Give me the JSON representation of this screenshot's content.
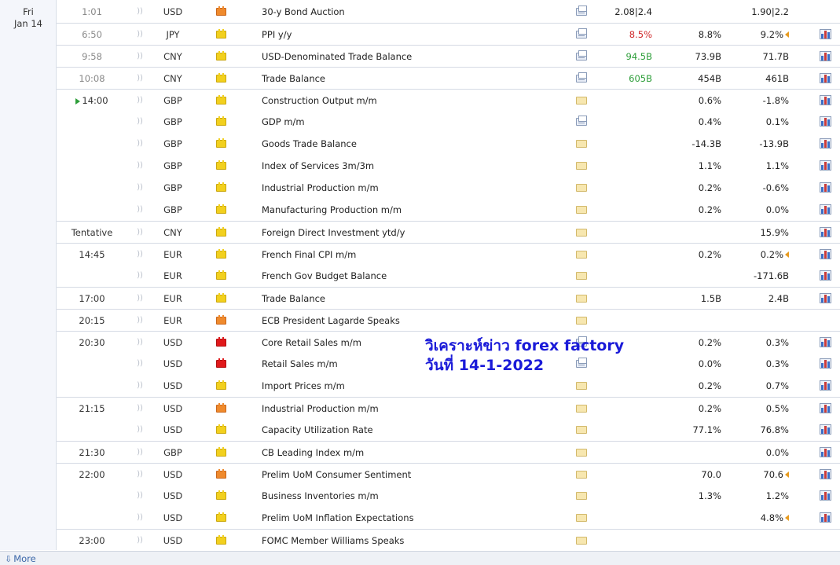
{
  "date": {
    "day": "Fri",
    "month_day": "Jan 14"
  },
  "rows": [
    {
      "time": "1:01",
      "time_state": "past",
      "currency": "USD",
      "impact": "med",
      "event": "30-y Bond Auction",
      "detail": "doc",
      "actual": "2.08|2.4",
      "actual_state": "neutral",
      "forecast": "",
      "previous": "1.90|2.2",
      "prev_rev": false,
      "graph": false,
      "sep": false
    },
    {
      "time": "6:50",
      "time_state": "past",
      "currency": "JPY",
      "impact": "low",
      "event": "PPI y/y",
      "detail": "doc",
      "actual": "8.5%",
      "actual_state": "bad",
      "forecast": "8.8%",
      "previous": "9.2%",
      "prev_rev": true,
      "graph": true,
      "sep": true
    },
    {
      "time": "9:58",
      "time_state": "past",
      "currency": "CNY",
      "impact": "low",
      "event": "USD-Denominated Trade Balance",
      "detail": "doc",
      "actual": "94.5B",
      "actual_state": "good",
      "forecast": "73.9B",
      "previous": "71.7B",
      "prev_rev": false,
      "graph": true,
      "sep": true
    },
    {
      "time": "10:08",
      "time_state": "past",
      "currency": "CNY",
      "impact": "low",
      "event": "Trade Balance",
      "detail": "doc",
      "actual": "605B",
      "actual_state": "good",
      "forecast": "454B",
      "previous": "461B",
      "prev_rev": false,
      "graph": true,
      "sep": true
    },
    {
      "time": "14:00",
      "time_state": "now",
      "currency": "GBP",
      "impact": "low",
      "event": "Construction Output m/m",
      "detail": "folder",
      "actual": "",
      "actual_state": "neutral",
      "forecast": "0.6%",
      "previous": "-1.8%",
      "prev_rev": false,
      "graph": true,
      "sep": true
    },
    {
      "time": "",
      "time_state": "",
      "currency": "GBP",
      "impact": "low",
      "event": "GDP m/m",
      "detail": "doc",
      "actual": "",
      "actual_state": "neutral",
      "forecast": "0.4%",
      "previous": "0.1%",
      "prev_rev": false,
      "graph": true,
      "sep": false
    },
    {
      "time": "",
      "time_state": "",
      "currency": "GBP",
      "impact": "low",
      "event": "Goods Trade Balance",
      "detail": "folder",
      "actual": "",
      "actual_state": "neutral",
      "forecast": "-14.3B",
      "previous": "-13.9B",
      "prev_rev": false,
      "graph": true,
      "sep": false
    },
    {
      "time": "",
      "time_state": "",
      "currency": "GBP",
      "impact": "low",
      "event": "Index of Services 3m/3m",
      "detail": "folder",
      "actual": "",
      "actual_state": "neutral",
      "forecast": "1.1%",
      "previous": "1.1%",
      "prev_rev": false,
      "graph": true,
      "sep": false
    },
    {
      "time": "",
      "time_state": "",
      "currency": "GBP",
      "impact": "low",
      "event": "Industrial Production m/m",
      "detail": "folder",
      "actual": "",
      "actual_state": "neutral",
      "forecast": "0.2%",
      "previous": "-0.6%",
      "prev_rev": false,
      "graph": true,
      "sep": false
    },
    {
      "time": "",
      "time_state": "",
      "currency": "GBP",
      "impact": "low",
      "event": "Manufacturing Production m/m",
      "detail": "folder",
      "actual": "",
      "actual_state": "neutral",
      "forecast": "0.2%",
      "previous": "0.0%",
      "prev_rev": false,
      "graph": true,
      "sep": false
    },
    {
      "time": "Tentative",
      "time_state": "",
      "currency": "CNY",
      "impact": "low",
      "event": "Foreign Direct Investment ytd/y",
      "detail": "folder",
      "actual": "",
      "actual_state": "neutral",
      "forecast": "",
      "previous": "15.9%",
      "prev_rev": false,
      "graph": true,
      "sep": true
    },
    {
      "time": "14:45",
      "time_state": "",
      "currency": "EUR",
      "impact": "low",
      "event": "French Final CPI m/m",
      "detail": "folder",
      "actual": "",
      "actual_state": "neutral",
      "forecast": "0.2%",
      "previous": "0.2%",
      "prev_rev": true,
      "graph": true,
      "sep": true
    },
    {
      "time": "",
      "time_state": "",
      "currency": "EUR",
      "impact": "low",
      "event": "French Gov Budget Balance",
      "detail": "folder",
      "actual": "",
      "actual_state": "neutral",
      "forecast": "",
      "previous": "-171.6B",
      "prev_rev": false,
      "graph": true,
      "sep": false
    },
    {
      "time": "17:00",
      "time_state": "",
      "currency": "EUR",
      "impact": "low",
      "event": "Trade Balance",
      "detail": "folder",
      "actual": "",
      "actual_state": "neutral",
      "forecast": "1.5B",
      "previous": "2.4B",
      "prev_rev": false,
      "graph": true,
      "sep": true
    },
    {
      "time": "20:15",
      "time_state": "",
      "currency": "EUR",
      "impact": "med",
      "event": "ECB President Lagarde Speaks",
      "detail": "folder",
      "actual": "",
      "actual_state": "neutral",
      "forecast": "",
      "previous": "",
      "prev_rev": false,
      "graph": false,
      "sep": true
    },
    {
      "time": "20:30",
      "time_state": "",
      "currency": "USD",
      "impact": "high",
      "event": "Core Retail Sales m/m",
      "detail": "doc",
      "actual": "",
      "actual_state": "neutral",
      "forecast": "0.2%",
      "previous": "0.3%",
      "prev_rev": false,
      "graph": true,
      "sep": true
    },
    {
      "time": "",
      "time_state": "",
      "currency": "USD",
      "impact": "high",
      "event": "Retail Sales m/m",
      "detail": "doc",
      "actual": "",
      "actual_state": "neutral",
      "forecast": "0.0%",
      "previous": "0.3%",
      "prev_rev": false,
      "graph": true,
      "sep": false
    },
    {
      "time": "",
      "time_state": "",
      "currency": "USD",
      "impact": "low",
      "event": "Import Prices m/m",
      "detail": "folder",
      "actual": "",
      "actual_state": "neutral",
      "forecast": "0.2%",
      "previous": "0.7%",
      "prev_rev": false,
      "graph": true,
      "sep": false
    },
    {
      "time": "21:15",
      "time_state": "",
      "currency": "USD",
      "impact": "med",
      "event": "Industrial Production m/m",
      "detail": "folder",
      "actual": "",
      "actual_state": "neutral",
      "forecast": "0.2%",
      "previous": "0.5%",
      "prev_rev": false,
      "graph": true,
      "sep": true
    },
    {
      "time": "",
      "time_state": "",
      "currency": "USD",
      "impact": "low",
      "event": "Capacity Utilization Rate",
      "detail": "folder",
      "actual": "",
      "actual_state": "neutral",
      "forecast": "77.1%",
      "previous": "76.8%",
      "prev_rev": false,
      "graph": true,
      "sep": false
    },
    {
      "time": "21:30",
      "time_state": "",
      "currency": "GBP",
      "impact": "low",
      "event": "CB Leading Index m/m",
      "detail": "folder",
      "actual": "",
      "actual_state": "neutral",
      "forecast": "",
      "previous": "0.0%",
      "prev_rev": false,
      "graph": true,
      "sep": true
    },
    {
      "time": "22:00",
      "time_state": "",
      "currency": "USD",
      "impact": "med",
      "event": "Prelim UoM Consumer Sentiment",
      "detail": "folder",
      "actual": "",
      "actual_state": "neutral",
      "forecast": "70.0",
      "previous": "70.6",
      "prev_rev": true,
      "graph": true,
      "sep": true
    },
    {
      "time": "",
      "time_state": "",
      "currency": "USD",
      "impact": "low",
      "event": "Business Inventories m/m",
      "detail": "folder",
      "actual": "",
      "actual_state": "neutral",
      "forecast": "1.3%",
      "previous": "1.2%",
      "prev_rev": false,
      "graph": true,
      "sep": false
    },
    {
      "time": "",
      "time_state": "",
      "currency": "USD",
      "impact": "low",
      "event": "Prelim UoM Inflation Expectations",
      "detail": "folder",
      "actual": "",
      "actual_state": "neutral",
      "forecast": "",
      "previous": "4.8%",
      "prev_rev": true,
      "graph": true,
      "sep": false
    },
    {
      "time": "23:00",
      "time_state": "",
      "currency": "USD",
      "impact": "low",
      "event": "FOMC Member Williams Speaks",
      "detail": "folder",
      "actual": "",
      "actual_state": "neutral",
      "forecast": "",
      "previous": "",
      "prev_rev": false,
      "graph": false,
      "sep": true
    }
  ],
  "overlay": {
    "line1": "วิเคราะห์ข่าว forex factory",
    "line2": "วันที่  14-1-2022"
  },
  "footer": {
    "more_label": "More",
    "more_icon": "down-arrow-icon"
  },
  "colors": {
    "impact_low": "#f2d01e",
    "impact_med": "#ef8a2d",
    "impact_high": "#e0191b",
    "actual_good": "#2e9e3a",
    "actual_bad": "#d0282a",
    "overlay_text": "#1a1ad8"
  }
}
